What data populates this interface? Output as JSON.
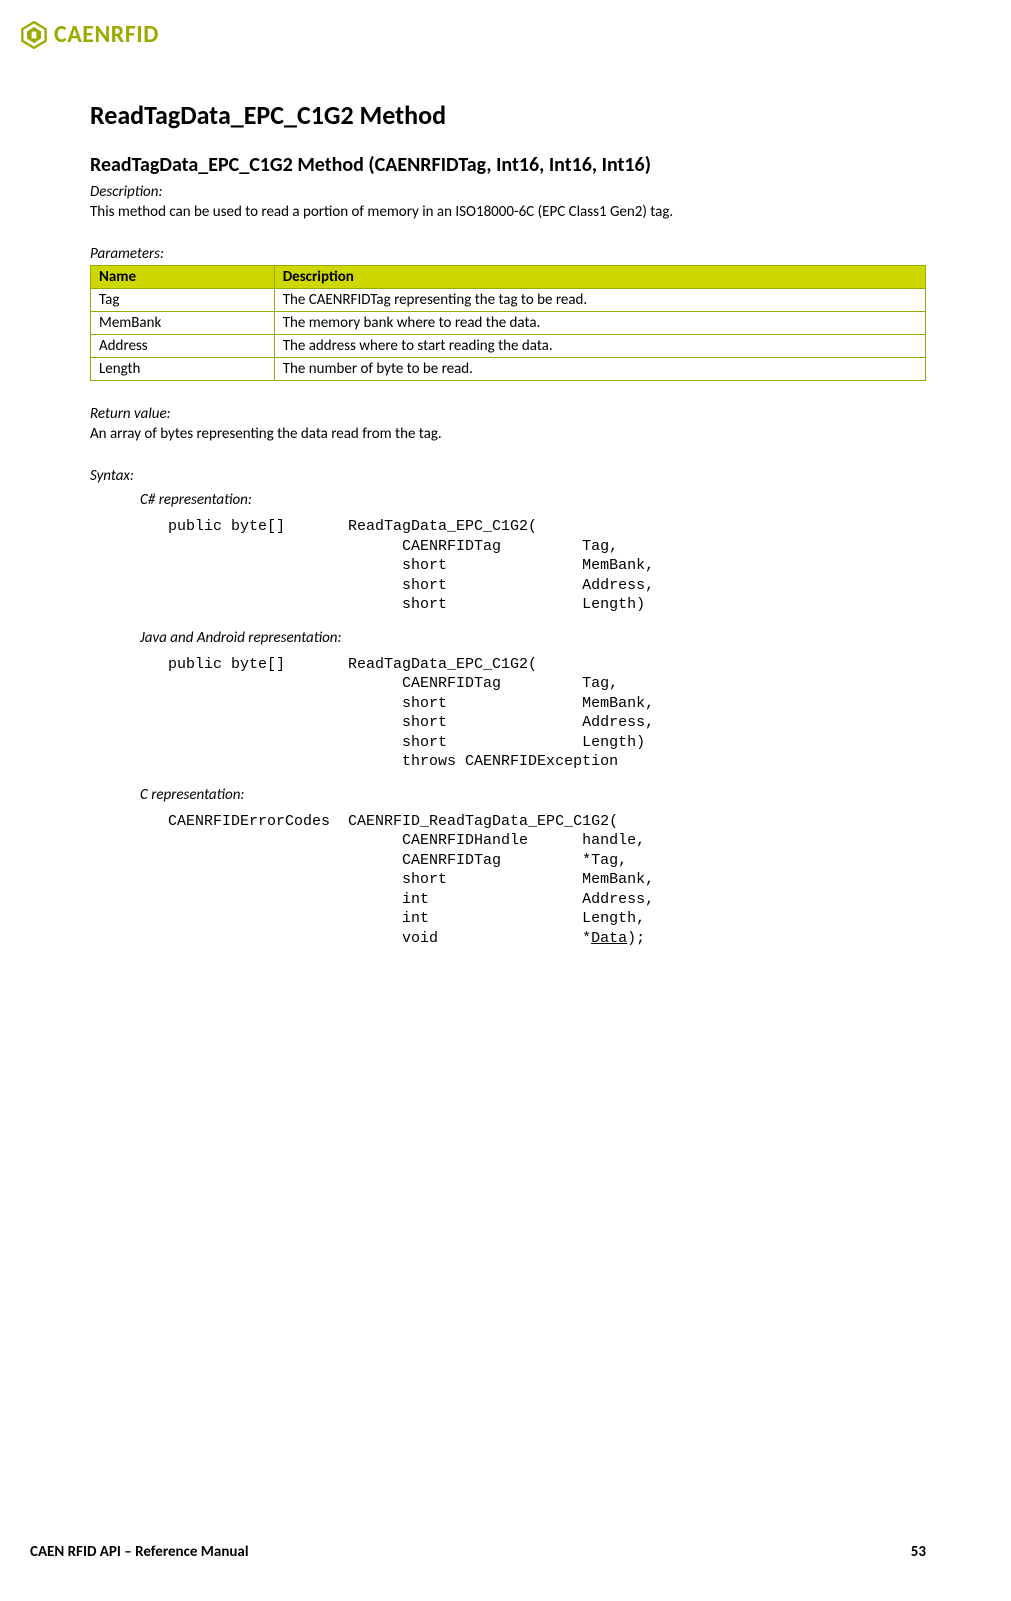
{
  "brand": "CAENRFID",
  "h1": "ReadTagData_EPC_C1G2 Method",
  "h2": "ReadTagData_EPC_C1G2 Method (CAENRFIDTag, Int16, Int16, Int16)",
  "desc_label": "Description:",
  "desc_text": "This method can be used to read a portion of memory in an ISO18000-6C (EPC Class1 Gen2) tag.",
  "params_label": "Parameters:",
  "table_header": {
    "name": "Name",
    "desc": "Description"
  },
  "params": [
    {
      "name": "Tag",
      "desc": "The CAENRFIDTag representing the tag to be read."
    },
    {
      "name": "MemBank",
      "desc": "The memory bank where to read the data."
    },
    {
      "name": "Address",
      "desc": "The address where to start reading the data."
    },
    {
      "name": "Length",
      "desc": "The number of byte to be read."
    }
  ],
  "ret_label": "Return value:",
  "ret_text": "An array of bytes representing the data read from the tag.",
  "syntax_label": "Syntax:",
  "repr1_label": "C# representation:",
  "repr1_code": "public byte[]       ReadTagData_EPC_C1G2(\n                          CAENRFIDTag         Tag,\n                          short               MemBank,\n                          short               Address,\n                          short               Length)",
  "repr2_label": "Java and Android representation:",
  "repr2_code": "public byte[]       ReadTagData_EPC_C1G2(\n                          CAENRFIDTag         Tag,\n                          short               MemBank,\n                          short               Address,\n                          short               Length)\n                          throws CAENRFIDException",
  "repr3_label": "C representation:",
  "repr3_code_pre": "CAENRFIDErrorCodes  CAENRFID_ReadTagData_EPC_C1G2(\n                          CAENRFIDHandle      handle,\n                          CAENRFIDTag         *Tag,\n                          short               MemBank,\n                          int                 Address,\n                          int                 Length,\n                          void                *",
  "repr3_code_data": "Data",
  "repr3_code_post": ");",
  "footer_left": "CAEN RFID API – Reference Manual",
  "footer_right": "53"
}
